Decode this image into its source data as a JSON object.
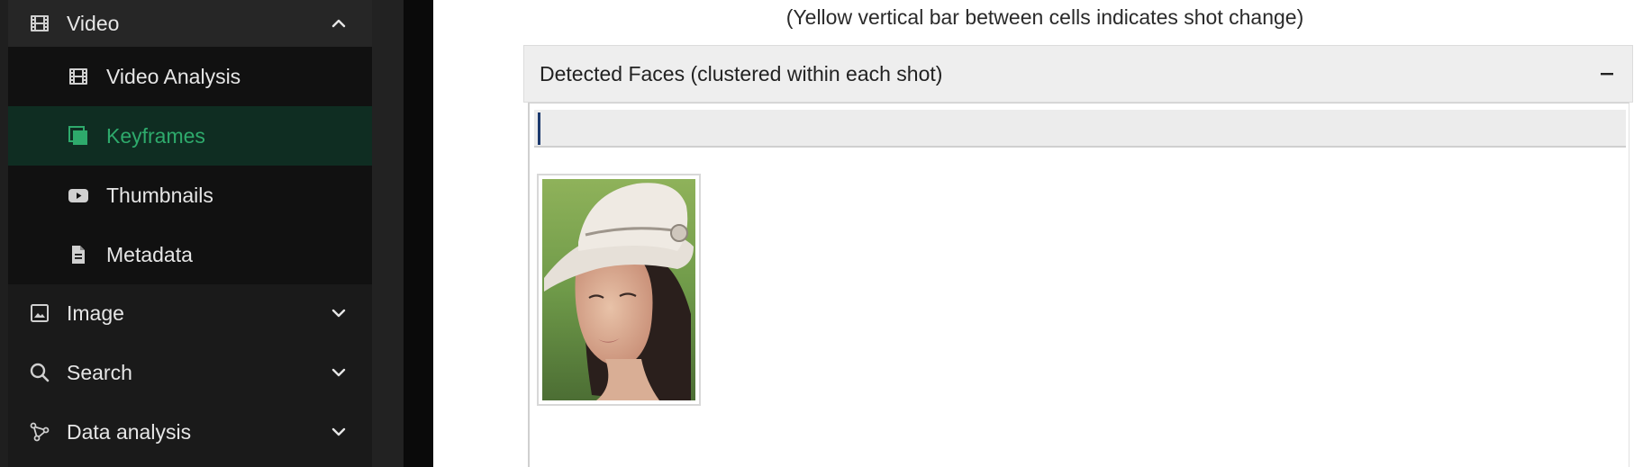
{
  "sidebar": {
    "video_group": {
      "label": "Video",
      "icon": "film-icon",
      "expanded": true
    },
    "subitems": [
      {
        "label": "Video Analysis",
        "icon": "film-icon",
        "active": false
      },
      {
        "label": "Keyframes",
        "icon": "layers-icon",
        "active": true
      },
      {
        "label": "Thumbnails",
        "icon": "youtube-icon",
        "active": false
      },
      {
        "label": "Metadata",
        "icon": "document-icon",
        "active": false
      }
    ],
    "groups": [
      {
        "label": "Image",
        "icon": "image-icon"
      },
      {
        "label": "Search",
        "icon": "search-icon"
      },
      {
        "label": "Data analysis",
        "icon": "graph-icon"
      }
    ],
    "active_color": "#2eaa6c"
  },
  "main": {
    "hint": "(Yellow vertical bar between cells indicates shot change)",
    "panel": {
      "title": "Detected Faces (clustered within each shot)",
      "collapse_symbol": "−",
      "filter_value": "",
      "faces": [
        {
          "name": "face-thumbnail"
        }
      ]
    }
  }
}
